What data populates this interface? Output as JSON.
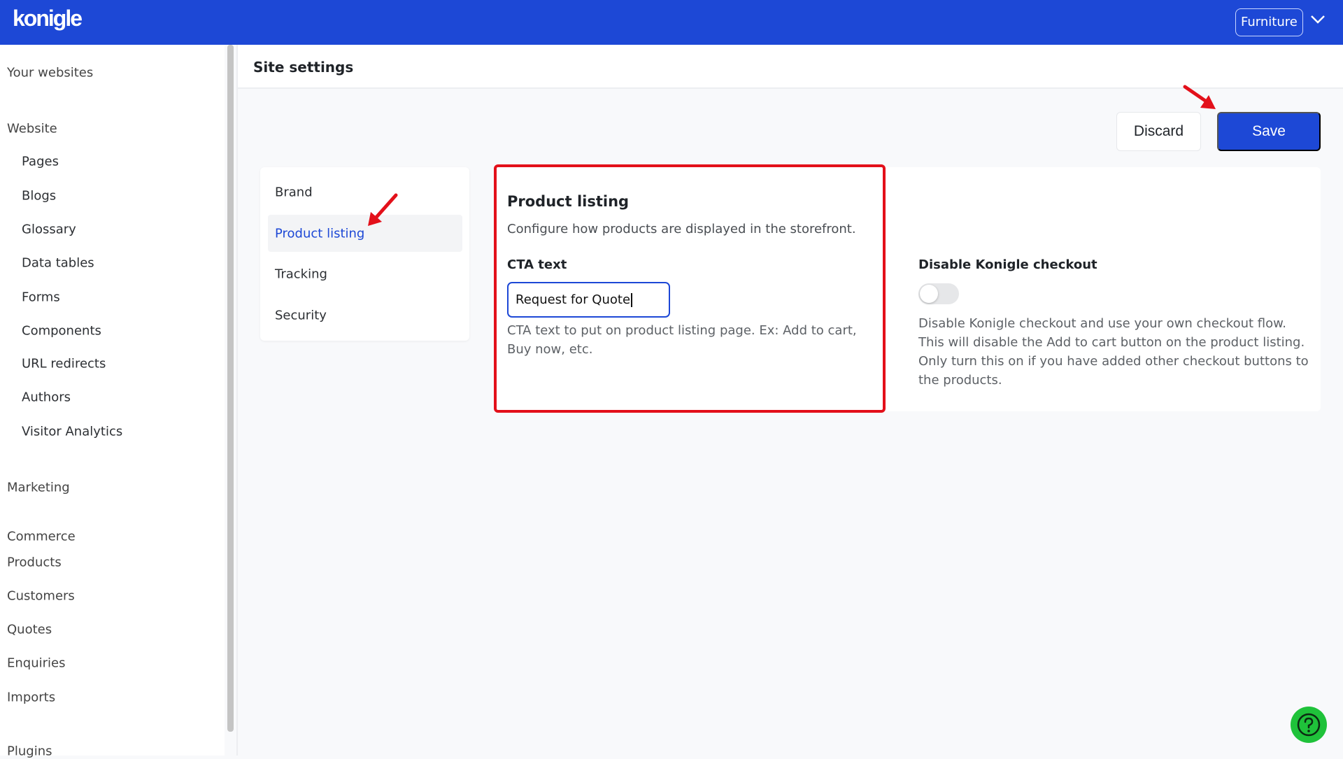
{
  "brand": {
    "logo": "konigle",
    "store_selector": "Furniture"
  },
  "sidebar": {
    "your_websites": "Your websites",
    "website": {
      "label": "Website",
      "items": [
        "Pages",
        "Blogs",
        "Glossary",
        "Data tables",
        "Forms",
        "Components",
        "URL redirects",
        "Authors",
        "Visitor Analytics"
      ]
    },
    "marketing": "Marketing",
    "commerce": {
      "label": "Commerce",
      "items": [
        "Products",
        "Customers",
        "Quotes",
        "Enquiries",
        "Imports"
      ]
    },
    "plugins": "Plugins"
  },
  "header": {
    "title": "Site settings"
  },
  "actions": {
    "discard": "Discard",
    "save": "Save"
  },
  "tabs": {
    "items": [
      "Brand",
      "Product listing",
      "Tracking",
      "Security"
    ],
    "active": "Product listing"
  },
  "product_listing": {
    "title": "Product listing",
    "description": "Configure how products are displayed in the storefront.",
    "cta_label": "CTA text",
    "cta_value": "Request for Quote",
    "cta_help": "CTA text to put on product listing page. Ex: Add to cart, Buy now, etc."
  },
  "checkout": {
    "label": "Disable Konigle checkout",
    "enabled": false,
    "help": "Disable Konigle checkout and use your own checkout flow. This will disable the Add to cart button on the product listing. Only turn this on if you have added other checkout buttons to the products."
  },
  "colors": {
    "primary": "#1d48d6",
    "highlight": "#e3101a",
    "help_button": "#1fc23a"
  },
  "icons": {
    "help": "question-circle-icon",
    "dropdown": "chevron-down-icon",
    "annotation": "red-arrow-icon"
  }
}
